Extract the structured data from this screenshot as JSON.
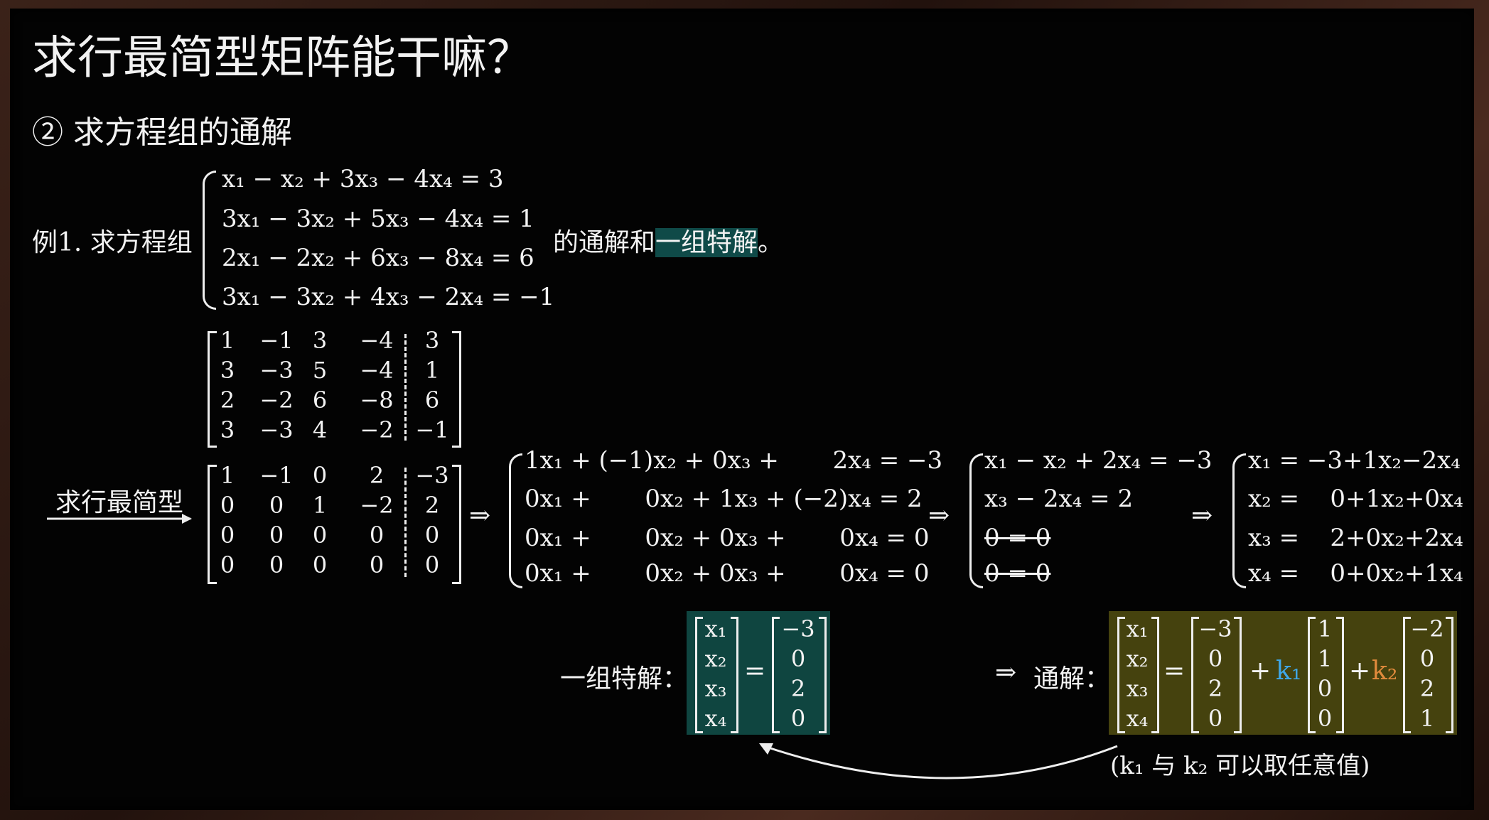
{
  "title": "求行最简型矩阵能干嘛？",
  "subtitle": "② 求方程组的通解",
  "example": {
    "label": "例1. 求方程组",
    "suffix_before": "的通解和",
    "highlight": "一组特解",
    "suffix_after": "。",
    "equations": [
      "x₁ − x₂ + 3x₃ − 4x₄ = 3",
      "3x₁ − 3x₂ + 5x₃ − 4x₄ = 1",
      "2x₁ − 2x₂ + 6x₃ − 8x₄ = 6",
      "3x₁ − 3x₂ + 4x₃ − 2x₄ = −1"
    ]
  },
  "augmented": {
    "rows": [
      [
        "1",
        "−1",
        "3",
        "−4",
        "3"
      ],
      [
        "3",
        "−3",
        "5",
        "−4",
        "1"
      ],
      [
        "2",
        "−2",
        "6",
        "−8",
        "6"
      ],
      [
        "3",
        "−3",
        "4",
        "−2",
        "−1"
      ]
    ]
  },
  "rref": {
    "arrow_label": "求行最简型",
    "rows": [
      [
        "1",
        "−1",
        "0",
        "2",
        "−3"
      ],
      [
        "0",
        "0",
        "1",
        "−2",
        "2"
      ],
      [
        "0",
        "0",
        "0",
        "0",
        "0"
      ],
      [
        "0",
        "0",
        "0",
        "0",
        "0"
      ]
    ]
  },
  "implies": "⇒",
  "system_full": [
    "1x₁ + (−1)x₂ + 0x₃ +       2x₄ = −3",
    "0x₁ +       0x₂ + 1x₃ + (−2)x₄ = 2",
    "0x₁ +       0x₂ + 0x₃ +       0x₄ = 0",
    "0x₁ +       0x₂ + 0x₃ +       0x₄ = 0"
  ],
  "system_reduced": [
    "x₁ − x₂ + 2x₄ = −3",
    "x₃ − 2x₄ = 2",
    "0 = 0",
    "0 = 0"
  ],
  "system_free": [
    "x₁ = −3+1x₂−2x₄",
    "x₂ =    0+1x₂+0x₄",
    "x₃ =    2+0x₂+2x₄",
    "x₄ =    0+0x₂+1x₄"
  ],
  "particular": {
    "label": "一组特解：",
    "vars": [
      "x₁",
      "x₂",
      "x₃",
      "x₄"
    ],
    "eq": "=",
    "values": [
      "−3",
      "0",
      "2",
      "0"
    ]
  },
  "general": {
    "label": "通解：",
    "vars": [
      "x₁",
      "x₂",
      "x₃",
      "x₄"
    ],
    "eq": "=",
    "v0": [
      "−3",
      "0",
      "2",
      "0"
    ],
    "plus": "+",
    "k1": "k₁",
    "v1": [
      "1",
      "1",
      "0",
      "0"
    ],
    "k2": "k₂",
    "v2": [
      "−2",
      "0",
      "2",
      "1"
    ],
    "note": "(k₁ 与 k₂ 可以取任意值)"
  },
  "colors": {
    "teal_box": "#0f4540",
    "olive_box": "#45420e",
    "k1": "#3fa7e8",
    "k2": "#e08a3c"
  }
}
